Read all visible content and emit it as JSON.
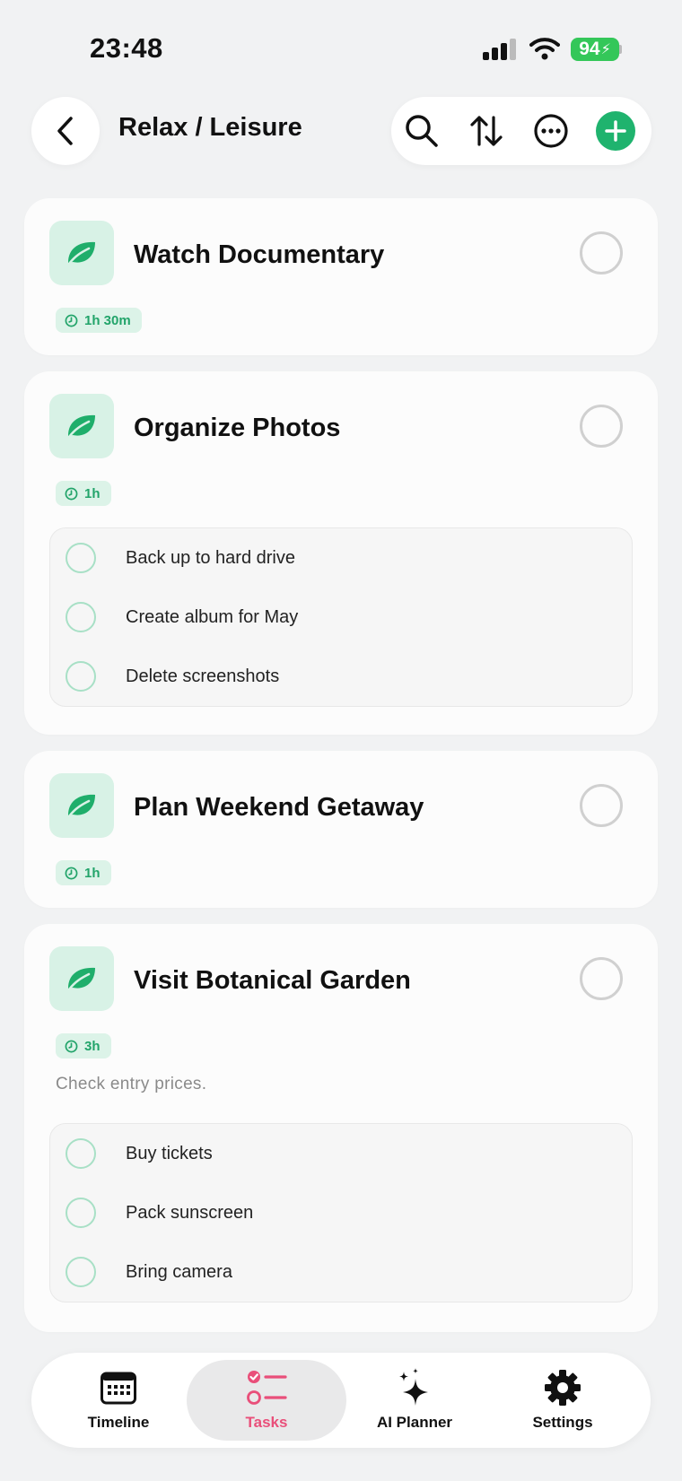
{
  "status_bar": {
    "time": "23:48",
    "battery": "94"
  },
  "header": {
    "title": "Relax / Leisure"
  },
  "tasks": [
    {
      "title": "Watch Documentary",
      "duration": "1h 30m",
      "note": "",
      "subtasks": []
    },
    {
      "title": "Organize Photos",
      "duration": "1h",
      "note": "",
      "subtasks": [
        "Back up to hard drive",
        "Create album for May",
        "Delete screenshots"
      ]
    },
    {
      "title": "Plan Weekend Getaway",
      "duration": "1h",
      "note": "",
      "subtasks": []
    },
    {
      "title": "Visit Botanical Garden",
      "duration": "3h",
      "note": "Check entry prices.",
      "subtasks": [
        "Buy tickets",
        "Pack sunscreen",
        "Bring camera"
      ]
    }
  ],
  "tabbar": {
    "items": [
      {
        "label": "Timeline",
        "icon": "calendar-icon"
      },
      {
        "label": "Tasks",
        "icon": "task-list-icon",
        "active": true
      },
      {
        "label": "AI Planner",
        "icon": "sparkles-icon"
      },
      {
        "label": "Settings",
        "icon": "gear-icon"
      }
    ]
  },
  "colors": {
    "accent": "#22a46a",
    "active_tab": "#e94f7a",
    "icon_bg": "#d8f2e6",
    "battery": "#34c759"
  }
}
